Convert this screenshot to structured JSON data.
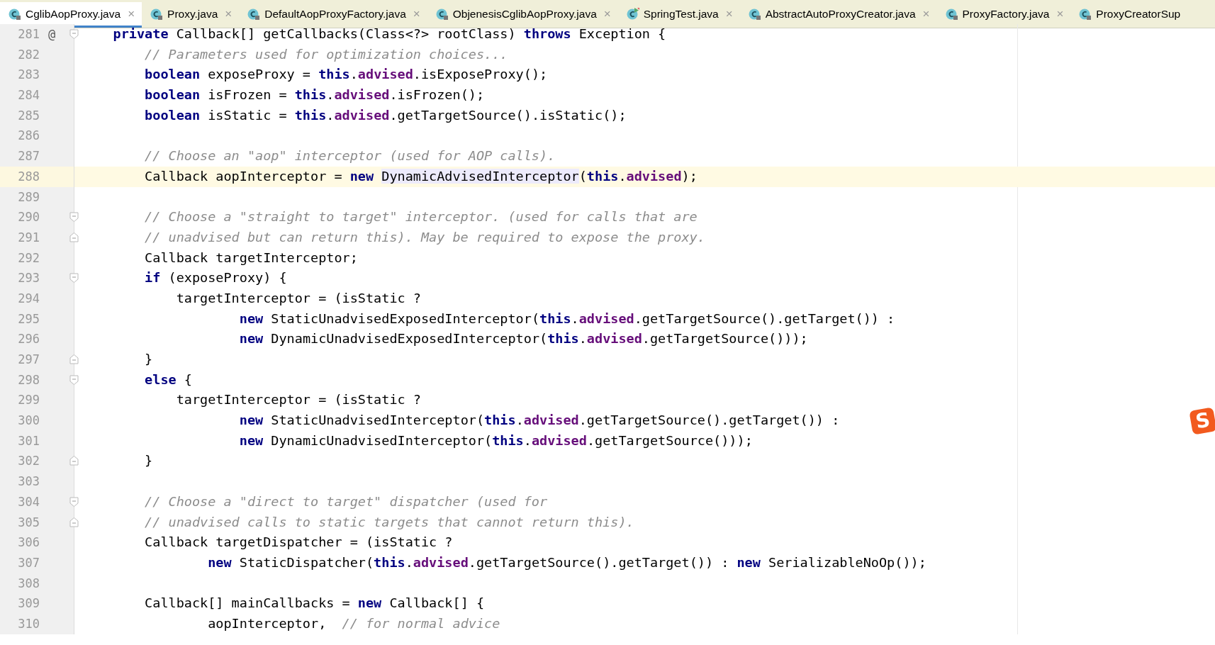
{
  "tabs": [
    {
      "label": "CglibAopProxy.java",
      "kind": "locked",
      "selected": true,
      "close": "×"
    },
    {
      "label": "Proxy.java",
      "kind": "locked",
      "selected": false,
      "close": "×"
    },
    {
      "label": "DefaultAopProxyFactory.java",
      "kind": "locked",
      "selected": false,
      "close": "×"
    },
    {
      "label": "ObjenesisCglibAopProxy.java",
      "kind": "locked",
      "selected": false,
      "close": "×"
    },
    {
      "label": "SpringTest.java",
      "kind": "runnable",
      "selected": false,
      "close": "×"
    },
    {
      "label": "AbstractAutoProxyCreator.java",
      "kind": "locked",
      "selected": false,
      "close": "×"
    },
    {
      "label": "ProxyFactory.java",
      "kind": "locked",
      "selected": false,
      "close": "×"
    },
    {
      "label": "ProxyCreatorSup",
      "kind": "locked",
      "selected": false
    }
  ],
  "editor": {
    "lines": [
      {
        "number": "281",
        "marker": "@",
        "fold_start": true,
        "fold_end": false,
        "current": false,
        "tokens": [
          {
            "kind": "keyword",
            "text": "    private"
          },
          {
            "kind": "plain",
            "text": " Callback[] getCallbacks(Class<?> rootClass) "
          },
          {
            "kind": "keyword",
            "text": "throws"
          },
          {
            "kind": "plain",
            "text": " Exception {"
          }
        ]
      },
      {
        "number": "282",
        "fold_start": false,
        "fold_end": false,
        "current": false,
        "tokens": [
          {
            "kind": "comment",
            "text": "        // Parameters used for optimization choices..."
          }
        ]
      },
      {
        "number": "283",
        "fold_start": false,
        "fold_end": false,
        "current": false,
        "tokens": [
          {
            "kind": "keyword",
            "text": "        boolean"
          },
          {
            "kind": "plain",
            "text": " exposeProxy = "
          },
          {
            "kind": "keyword",
            "text": "this"
          },
          {
            "kind": "plain",
            "text": "."
          },
          {
            "kind": "field",
            "text": "advised"
          },
          {
            "kind": "plain",
            "text": ".isExposeProxy();"
          }
        ]
      },
      {
        "number": "284",
        "fold_start": false,
        "fold_end": false,
        "current": false,
        "tokens": [
          {
            "kind": "keyword",
            "text": "        boolean"
          },
          {
            "kind": "plain",
            "text": " isFrozen = "
          },
          {
            "kind": "keyword",
            "text": "this"
          },
          {
            "kind": "plain",
            "text": "."
          },
          {
            "kind": "field",
            "text": "advised"
          },
          {
            "kind": "plain",
            "text": ".isFrozen();"
          }
        ]
      },
      {
        "number": "285",
        "fold_start": false,
        "fold_end": false,
        "current": false,
        "tokens": [
          {
            "kind": "keyword",
            "text": "        boolean"
          },
          {
            "kind": "plain",
            "text": " isStatic = "
          },
          {
            "kind": "keyword",
            "text": "this"
          },
          {
            "kind": "plain",
            "text": "."
          },
          {
            "kind": "field",
            "text": "advised"
          },
          {
            "kind": "plain",
            "text": ".getTargetSource().isStatic();"
          }
        ]
      },
      {
        "number": "286",
        "fold_start": false,
        "fold_end": false,
        "current": false
      },
      {
        "number": "287",
        "fold_start": false,
        "fold_end": false,
        "current": false,
        "tokens": [
          {
            "kind": "comment",
            "text": "        // Choose an \"aop\" interceptor (used for AOP calls)."
          }
        ]
      },
      {
        "number": "288",
        "fold_start": false,
        "fold_end": false,
        "current": true,
        "tokens": [
          {
            "kind": "plain",
            "text": "        Callback aopInterceptor = "
          },
          {
            "kind": "keyword",
            "text": "new "
          },
          {
            "kind": "usage",
            "text": "DynamicAdvisedInterceptor"
          },
          {
            "kind": "plain",
            "text": "("
          },
          {
            "kind": "keyword",
            "text": "this"
          },
          {
            "kind": "plain",
            "text": "."
          },
          {
            "kind": "field",
            "text": "advised"
          },
          {
            "kind": "plain",
            "text": ");"
          }
        ]
      },
      {
        "number": "289",
        "fold_start": false,
        "fold_end": false,
        "current": false
      },
      {
        "number": "290",
        "fold_start": true,
        "fold_end": false,
        "current": false,
        "tokens": [
          {
            "kind": "comment",
            "text": "        // Choose a \"straight to target\" interceptor. (used for calls that are"
          }
        ]
      },
      {
        "number": "291",
        "fold_start": false,
        "fold_end": true,
        "current": false,
        "tokens": [
          {
            "kind": "comment",
            "text": "        // unadvised but can return this). May be required to expose the proxy."
          }
        ]
      },
      {
        "number": "292",
        "fold_start": false,
        "fold_end": false,
        "current": false,
        "tokens": [
          {
            "kind": "plain",
            "text": "        Callback targetInterceptor;"
          }
        ]
      },
      {
        "number": "293",
        "fold_start": true,
        "fold_end": false,
        "current": false,
        "tokens": [
          {
            "kind": "keyword",
            "text": "        if"
          },
          {
            "kind": "plain",
            "text": " (exposeProxy) {"
          }
        ]
      },
      {
        "number": "294",
        "fold_start": false,
        "fold_end": false,
        "current": false,
        "tokens": [
          {
            "kind": "plain",
            "text": "            targetInterceptor = (isStatic ?"
          }
        ]
      },
      {
        "number": "295",
        "fold_start": false,
        "fold_end": false,
        "current": false,
        "tokens": [
          {
            "kind": "keyword",
            "text": "                    new"
          },
          {
            "kind": "plain",
            "text": " StaticUnadvisedExposedInterceptor("
          },
          {
            "kind": "keyword",
            "text": "this"
          },
          {
            "kind": "plain",
            "text": "."
          },
          {
            "kind": "field",
            "text": "advised"
          },
          {
            "kind": "plain",
            "text": ".getTargetSource().getTarget()) :"
          }
        ]
      },
      {
        "number": "296",
        "fold_start": false,
        "fold_end": false,
        "current": false,
        "tokens": [
          {
            "kind": "keyword",
            "text": "                    new"
          },
          {
            "kind": "plain",
            "text": " DynamicUnadvisedExposedInterceptor("
          },
          {
            "kind": "keyword",
            "text": "this"
          },
          {
            "kind": "plain",
            "text": "."
          },
          {
            "kind": "field",
            "text": "advised"
          },
          {
            "kind": "plain",
            "text": ".getTargetSource()));"
          }
        ]
      },
      {
        "number": "297",
        "fold_start": false,
        "fold_end": true,
        "current": false,
        "tokens": [
          {
            "kind": "plain",
            "text": "        }"
          }
        ]
      },
      {
        "number": "298",
        "fold_start": true,
        "fold_end": false,
        "current": false,
        "tokens": [
          {
            "kind": "keyword",
            "text": "        else"
          },
          {
            "kind": "plain",
            "text": " {"
          }
        ]
      },
      {
        "number": "299",
        "fold_start": false,
        "fold_end": false,
        "current": false,
        "tokens": [
          {
            "kind": "plain",
            "text": "            targetInterceptor = (isStatic ?"
          }
        ]
      },
      {
        "number": "300",
        "fold_start": false,
        "fold_end": false,
        "current": false,
        "tokens": [
          {
            "kind": "keyword",
            "text": "                    new"
          },
          {
            "kind": "plain",
            "text": " StaticUnadvisedInterceptor("
          },
          {
            "kind": "keyword",
            "text": "this"
          },
          {
            "kind": "plain",
            "text": "."
          },
          {
            "kind": "field",
            "text": "advised"
          },
          {
            "kind": "plain",
            "text": ".getTargetSource().getTarget()) :"
          }
        ]
      },
      {
        "number": "301",
        "fold_start": false,
        "fold_end": false,
        "current": false,
        "tokens": [
          {
            "kind": "keyword",
            "text": "                    new"
          },
          {
            "kind": "plain",
            "text": " DynamicUnadvisedInterceptor("
          },
          {
            "kind": "keyword",
            "text": "this"
          },
          {
            "kind": "plain",
            "text": "."
          },
          {
            "kind": "field",
            "text": "advised"
          },
          {
            "kind": "plain",
            "text": ".getTargetSource()));"
          }
        ]
      },
      {
        "number": "302",
        "fold_start": false,
        "fold_end": true,
        "current": false,
        "tokens": [
          {
            "kind": "plain",
            "text": "        }"
          }
        ]
      },
      {
        "number": "303",
        "fold_start": false,
        "fold_end": false,
        "current": false
      },
      {
        "number": "304",
        "fold_start": true,
        "fold_end": false,
        "current": false,
        "tokens": [
          {
            "kind": "comment",
            "text": "        // Choose a \"direct to target\" dispatcher (used for"
          }
        ]
      },
      {
        "number": "305",
        "fold_start": false,
        "fold_end": true,
        "current": false,
        "tokens": [
          {
            "kind": "comment",
            "text": "        // unadvised calls to static targets that cannot return this)."
          }
        ]
      },
      {
        "number": "306",
        "fold_start": false,
        "fold_end": false,
        "current": false,
        "tokens": [
          {
            "kind": "plain",
            "text": "        Callback targetDispatcher = (isStatic ?"
          }
        ]
      },
      {
        "number": "307",
        "fold_start": false,
        "fold_end": false,
        "current": false,
        "tokens": [
          {
            "kind": "keyword",
            "text": "                new"
          },
          {
            "kind": "plain",
            "text": " StaticDispatcher("
          },
          {
            "kind": "keyword",
            "text": "this"
          },
          {
            "kind": "plain",
            "text": "."
          },
          {
            "kind": "field",
            "text": "advised"
          },
          {
            "kind": "plain",
            "text": ".getTargetSource().getTarget()) : "
          },
          {
            "kind": "keyword",
            "text": "new"
          },
          {
            "kind": "plain",
            "text": " SerializableNoOp());"
          }
        ]
      },
      {
        "number": "308",
        "fold_start": false,
        "fold_end": false,
        "current": false
      },
      {
        "number": "309",
        "fold_start": false,
        "fold_end": false,
        "current": false,
        "tokens": [
          {
            "kind": "plain",
            "text": "        Callback[] mainCallbacks = "
          },
          {
            "kind": "keyword",
            "text": "new"
          },
          {
            "kind": "plain",
            "text": " Callback[] {"
          }
        ]
      },
      {
        "number": "310",
        "fold_start": false,
        "fold_end": false,
        "current": false,
        "tokens": [
          {
            "kind": "plain",
            "text": "                aopInterceptor,  "
          },
          {
            "kind": "comment",
            "text": "// for normal advice"
          }
        ]
      }
    ]
  },
  "ime_badge": {
    "label": "S"
  }
}
